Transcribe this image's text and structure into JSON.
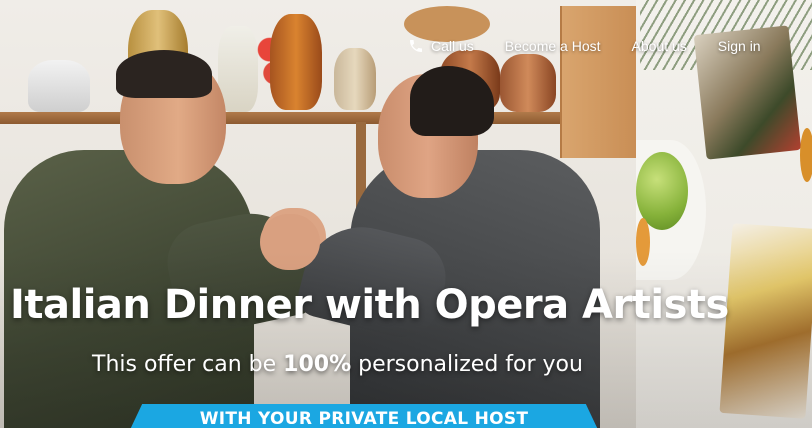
{
  "nav": {
    "call_label": "Call us",
    "host_label": "Become a Host",
    "about_label": "About us",
    "signin_label": "Sign in"
  },
  "hero": {
    "title": "Italian Dinner with Opera Artists",
    "subtitle_pre": "This offer can be ",
    "subtitle_bold": "100%",
    "subtitle_post": " personalized for you",
    "cta_label": "WITH YOUR PRIVATE LOCAL HOST"
  },
  "colors": {
    "accent": "#1ba7e2",
    "text_on_image": "#ffffff"
  },
  "icons": {
    "call": "phone-icon"
  }
}
